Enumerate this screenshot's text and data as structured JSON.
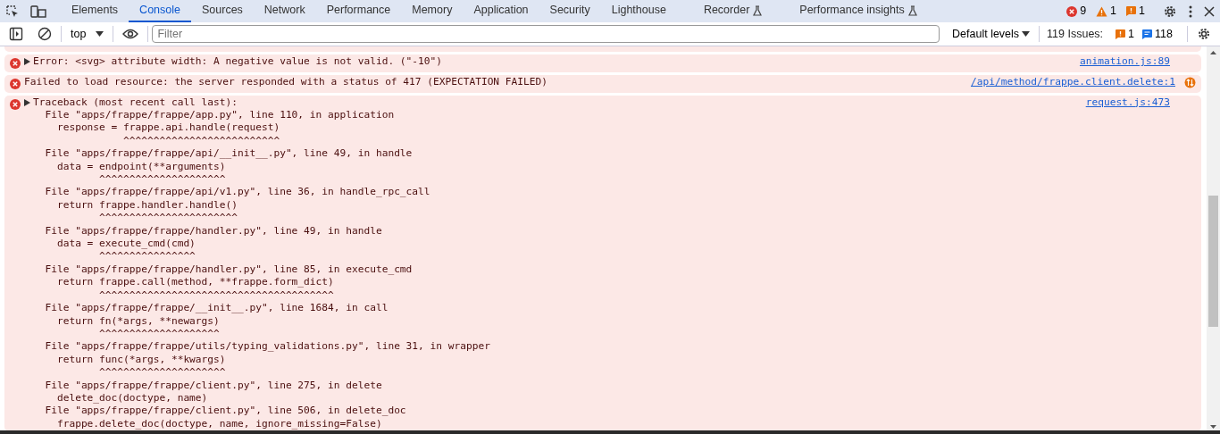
{
  "tabs": [
    {
      "label": "Elements",
      "selected": false,
      "experimental": false
    },
    {
      "label": "Console",
      "selected": true,
      "experimental": false
    },
    {
      "label": "Sources",
      "selected": false,
      "experimental": false
    },
    {
      "label": "Network",
      "selected": false,
      "experimental": false
    },
    {
      "label": "Performance",
      "selected": false,
      "experimental": false
    },
    {
      "label": "Memory",
      "selected": false,
      "experimental": false
    },
    {
      "label": "Application",
      "selected": false,
      "experimental": false
    },
    {
      "label": "Security",
      "selected": false,
      "experimental": false
    },
    {
      "label": "Lighthouse",
      "selected": false,
      "experimental": false
    },
    {
      "label": "Recorder",
      "selected": false,
      "experimental": true
    },
    {
      "label": "Performance insights",
      "selected": false,
      "experimental": true
    }
  ],
  "counters": [
    {
      "kind": "error",
      "count": "9"
    },
    {
      "kind": "warning",
      "count": "1"
    },
    {
      "kind": "issue",
      "count": "1"
    }
  ],
  "toolbar": {
    "context": "top",
    "filter_placeholder": "Filter",
    "levels": "Default levels",
    "issues_label": "119 Issues:",
    "issue_counts": [
      {
        "kind": "issue",
        "count": "1"
      },
      {
        "kind": "info",
        "count": "118"
      }
    ]
  },
  "messages": [
    {
      "kind": "clipped"
    },
    {
      "kind": "error",
      "expandable": true,
      "network": false,
      "lines": [
        "Error: <svg> attribute width: A negative value is not valid. (\"-10\")"
      ],
      "source": "animation.js:89"
    },
    {
      "kind": "error",
      "expandable": false,
      "network": true,
      "lines": [
        "Failed to load resource: the server responded with a status of 417 (EXPECTATION FAILED)"
      ],
      "source": "/api/method/frappe.client.delete:1"
    },
    {
      "kind": "error",
      "expandable": true,
      "network": false,
      "source": "request.js:473",
      "lines": [
        "Traceback (most recent call last):",
        "  File \"apps/frappe/frappe/app.py\", line 110, in application",
        "    response = frappe.api.handle(request)",
        "               ^^^^^^^^^^^^^^^^^^^^^^^^^^",
        "  File \"apps/frappe/frappe/api/__init__.py\", line 49, in handle",
        "    data = endpoint(**arguments)",
        "           ^^^^^^^^^^^^^^^^^^^^^",
        "  File \"apps/frappe/frappe/api/v1.py\", line 36, in handle_rpc_call",
        "    return frappe.handler.handle()",
        "           ^^^^^^^^^^^^^^^^^^^^^^^",
        "  File \"apps/frappe/frappe/handler.py\", line 49, in handle",
        "    data = execute_cmd(cmd)",
        "           ^^^^^^^^^^^^^^^^",
        "  File \"apps/frappe/frappe/handler.py\", line 85, in execute_cmd",
        "    return frappe.call(method, **frappe.form_dict)",
        "           ^^^^^^^^^^^^^^^^^^^^^^^^^^^^^^^^^^^^^^^",
        "  File \"apps/frappe/frappe/__init__.py\", line 1684, in call",
        "    return fn(*args, **newargs)",
        "           ^^^^^^^^^^^^^^^^^^^^",
        "  File \"apps/frappe/frappe/utils/typing_validations.py\", line 31, in wrapper",
        "    return func(*args, **kwargs)",
        "           ^^^^^^^^^^^^^^^^^^^^^",
        "  File \"apps/frappe/frappe/client.py\", line 275, in delete",
        "    delete_doc(doctype, name)",
        "  File \"apps/frappe/frappe/client.py\", line 506, in delete_doc",
        "    frappe.delete_doc(doctype, name, ignore_missing=False)"
      ]
    }
  ]
}
